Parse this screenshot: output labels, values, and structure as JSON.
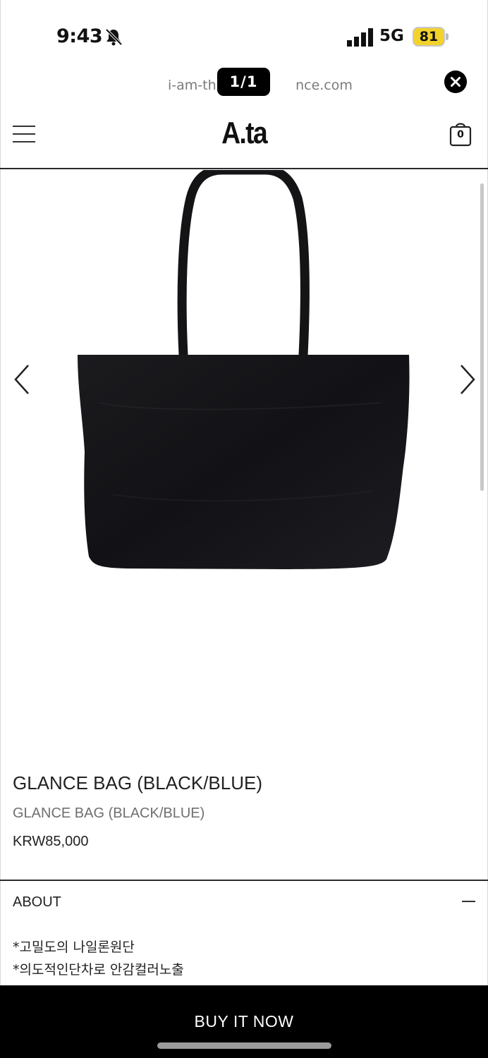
{
  "status_bar": {
    "time": "9:43",
    "network": "5G",
    "battery": "81"
  },
  "browser": {
    "url_left": "i-am-th",
    "url_right": "nce.com",
    "page_counter": "1/1"
  },
  "header": {
    "logo": "A.ta",
    "cart_count": "0"
  },
  "product": {
    "title": "GLANCE BAG (BLACK/BLUE)",
    "subtitle": "GLANCE BAG (BLACK/BLUE)",
    "price": "KRW85,000"
  },
  "about": {
    "title": "ABOUT",
    "lines": [
      "*고밀도의 나일론원단",
      "*의도적인단차로 안감컬러노출"
    ]
  },
  "buy_bar": {
    "label": "BUY IT NOW"
  },
  "icons": {
    "bell": "bell-slash-icon",
    "signal": "signal-bars-icon",
    "close": "close-icon",
    "menu": "hamburger-menu-icon",
    "cart": "shopping-bag-icon",
    "prev": "chevron-left-icon",
    "next": "chevron-right-icon"
  },
  "colors": {
    "accent": "#000000",
    "battery": "#f3d22b"
  }
}
